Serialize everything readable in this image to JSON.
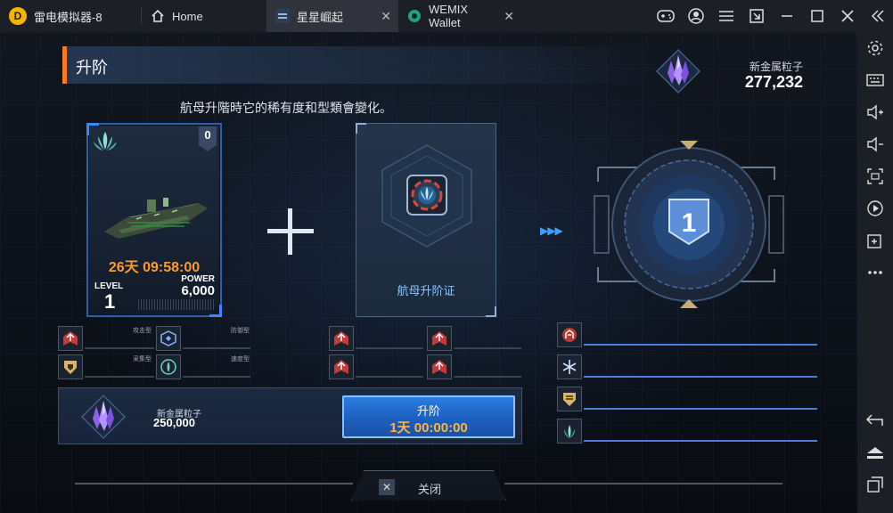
{
  "titlebar": {
    "app_name": "雷电模拟器-8",
    "tabs": [
      {
        "label": "Home"
      },
      {
        "label": "星星崛起"
      },
      {
        "label": "WEMIX Wallet"
      }
    ]
  },
  "sidebar": {
    "icons": [
      "gear-icon",
      "keyboard-icon",
      "volume-up-icon",
      "volume-down-icon",
      "screenshot-icon",
      "record-icon",
      "add-app-icon",
      "more-icon",
      "back-icon",
      "home-icon",
      "recents-icon"
    ]
  },
  "game": {
    "title": "升阶",
    "resource": {
      "label": "新金属粒子",
      "value": "277,232"
    },
    "description": "航母升階時它的稀有度和型類會變化。",
    "ship_card": {
      "badge": "0",
      "timer": "26天 09:58:00",
      "level_label": "LEVEL",
      "level_value": "1",
      "power_label": "POWER",
      "power_value": "6,000"
    },
    "certificate_label": "航母升阶证",
    "result_value": "1",
    "ship_stats": [
      {
        "name": "攻击型"
      },
      {
        "name": "防御型"
      },
      {
        "name": "采集型"
      },
      {
        "name": "速度型"
      }
    ],
    "cost": {
      "label": "新金属粒子",
      "value": "250,000"
    },
    "upgrade_button": {
      "label": "升阶",
      "time": "1天 00:00:00"
    },
    "close_label": "关闭",
    "colors": {
      "accent": "#ff7a1a",
      "button": "#2a7de0",
      "timer": "#ff9a2e"
    }
  }
}
